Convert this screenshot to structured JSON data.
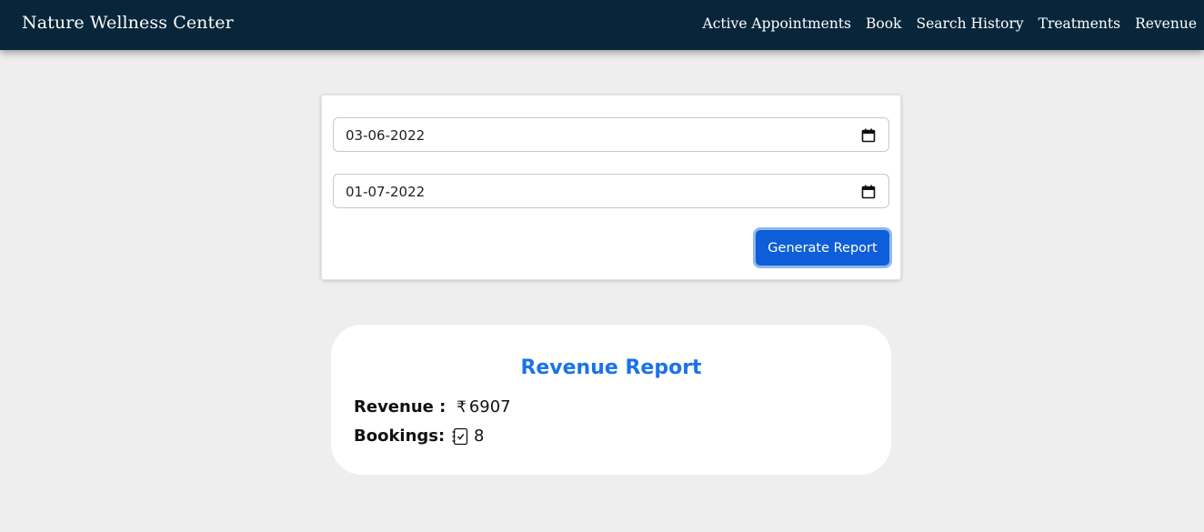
{
  "navbar": {
    "brand": "Nature Wellness Center",
    "links": [
      "Active Appointments",
      "Book",
      "Search History",
      "Treatments",
      "Revenue"
    ]
  },
  "form": {
    "start_date": "03-06-2022",
    "end_date": "01-07-2022",
    "submit_label": "Generate Report"
  },
  "report": {
    "title": "Revenue Report",
    "revenue_label": "Revenue :",
    "currency_symbol": "₹",
    "revenue_value": "6907",
    "bookings_label": "Bookings:",
    "bookings_value": "8",
    "icons": {
      "revenue": "rupee-icon",
      "bookings": "booking-checklist-icon"
    }
  },
  "colors": {
    "navbar": "#07263a",
    "button": "#0d5ed8",
    "title": "#1a73e8",
    "background": "#eeeeee"
  }
}
